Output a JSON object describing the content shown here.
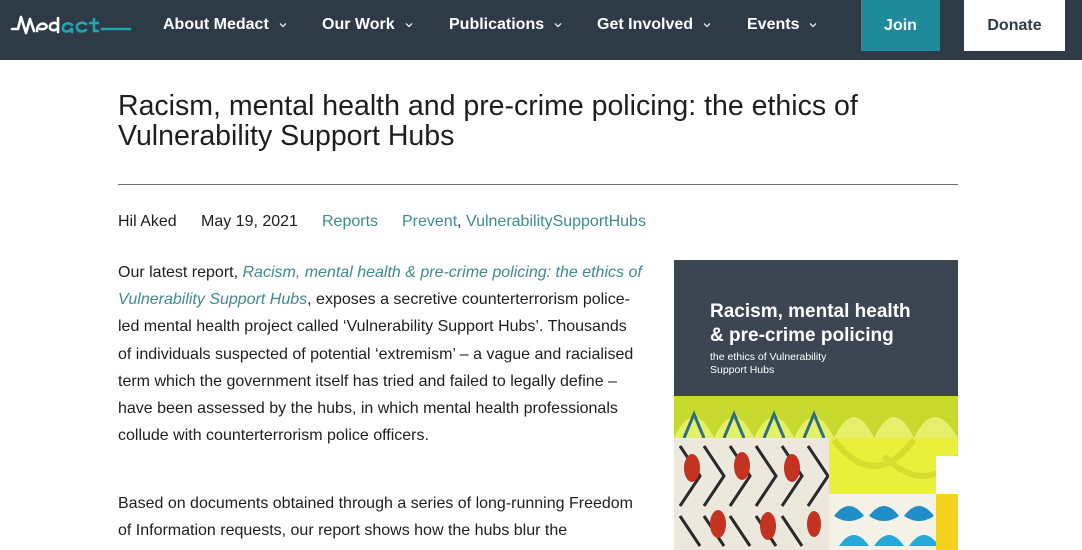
{
  "header": {
    "logo_icon": "medact-logo",
    "nav": [
      {
        "label": "About Medact"
      },
      {
        "label": "Our Work"
      },
      {
        "label": "Publications"
      },
      {
        "label": "Get Involved"
      },
      {
        "label": "Events"
      }
    ],
    "join_label": "Join",
    "donate_label": "Donate"
  },
  "article": {
    "title_line1": "Racism, mental health and pre-crime policing: the ethics of",
    "title_line2": "Vulnerability Support Hubs",
    "author": "Hil Aked",
    "date": "May 19, 2021",
    "category": "Reports",
    "tag1": "Prevent",
    "tag_separator": ",",
    "tag2": "VulnerabilitySupportHubs",
    "p1": {
      "intro": "Our latest report, ",
      "link_line1": "Racism, mental health & pre-crime policing: the ethics of",
      "link_line2": "Vulnerability Support Hubs",
      "line2_rest": ", exposes a secretive counterterrorism police-",
      "line3": "led mental health project called  ‘Vulnerability Support Hubs’. Thousands",
      "line4": "of individuals suspected of potential ‘extremism’ – a vague and racialised",
      "line5": "term which the government itself has tried and failed to legally define –",
      "line6": "have been assessed by the hubs, in which mental health professionals",
      "line7": "collude with counterterrorism police officers."
    },
    "p2": {
      "line1": "Based on documents obtained through a series of long-running Freedom",
      "line2": "of Information requests, our report shows how the hubs blur the"
    }
  },
  "cover": {
    "title_line1": "Racism, mental health",
    "title_line2": "& pre-crime policing",
    "subtitle_line1": "the ethics of Vulnerability",
    "subtitle_line2": "Support Hubs"
  },
  "colors": {
    "header_bg": "#2e3b47",
    "join_bg": "#1f8a99",
    "link": "#3f8a8f",
    "cover_bg": "#3b4652"
  }
}
